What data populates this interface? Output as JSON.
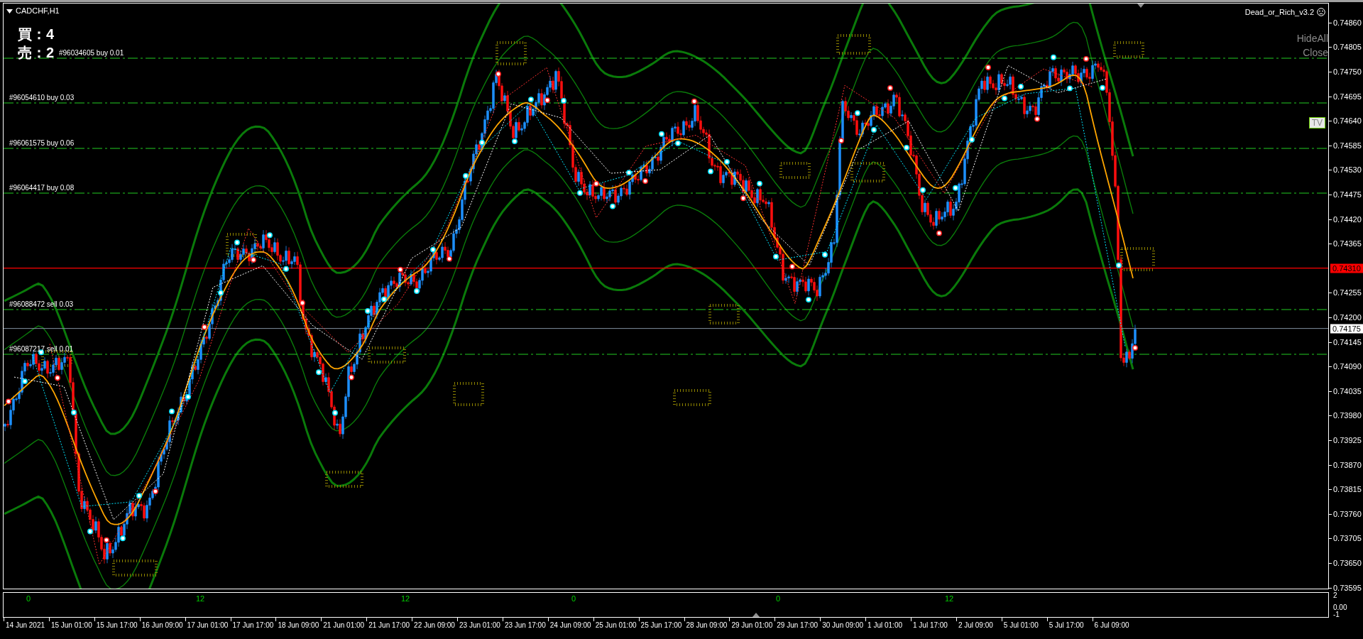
{
  "chart": {
    "title": "CADCHF,H1",
    "counters": [
      "買：4",
      "売：2"
    ],
    "expert_name": "Dead_or_Rich_v3.2",
    "panel_buttons": [
      "HideAll",
      "Close"
    ],
    "tv_button": "TV",
    "orders": [
      {
        "label": "#96034605 buy 0.01"
      },
      {
        "label": "#96054610 buy 0.03"
      },
      {
        "label": "#96061575 buy 0.06"
      },
      {
        "label": "#96064417 buy 0.08"
      },
      {
        "label": "#96088472 sell 0.03"
      },
      {
        "label": "#96087217 sell 0.01"
      }
    ]
  },
  "price_axis": {
    "labels": [
      "0.74860",
      "0.74805",
      "0.74750",
      "0.74695",
      "0.74640",
      "0.74585",
      "0.74530",
      "0.74475",
      "0.74420",
      "0.74365",
      "0.74255",
      "0.74200",
      "0.74145",
      "0.74090",
      "0.74035",
      "0.73980",
      "0.73925",
      "0.73870",
      "0.73815",
      "0.73760",
      "0.73705",
      "0.73650",
      "0.73595"
    ],
    "alert_price": "0.74310",
    "bid_price": "0.74175"
  },
  "indicator_window": {
    "hour_labels": [
      "0",
      "12",
      "12",
      "0",
      "0",
      "12"
    ],
    "scale_labels": [
      "2",
      "0.00",
      "-1"
    ]
  },
  "time_axis": [
    "14 Jun 2021",
    "15 Jun 01:00",
    "15 Jun 17:00",
    "16 Jun 09:00",
    "17 Jun 01:00",
    "17 Jun 17:00",
    "18 Jun 09:00",
    "21 Jun 01:00",
    "21 Jun 17:00",
    "22 Jun 09:00",
    "23 Jun 01:00",
    "23 Jun 17:00",
    "24 Jun 09:00",
    "25 Jun 01:00",
    "25 Jun 17:00",
    "28 Jun 09:00",
    "29 Jun 01:00",
    "29 Jun 17:00",
    "30 Jun 09:00",
    "1 Jul 01:00",
    "1 Jul 17:00",
    "2 Jul 09:00",
    "5 Jul 01:00",
    "5 Jul 17:00",
    "6 Jul 09:00"
  ]
}
